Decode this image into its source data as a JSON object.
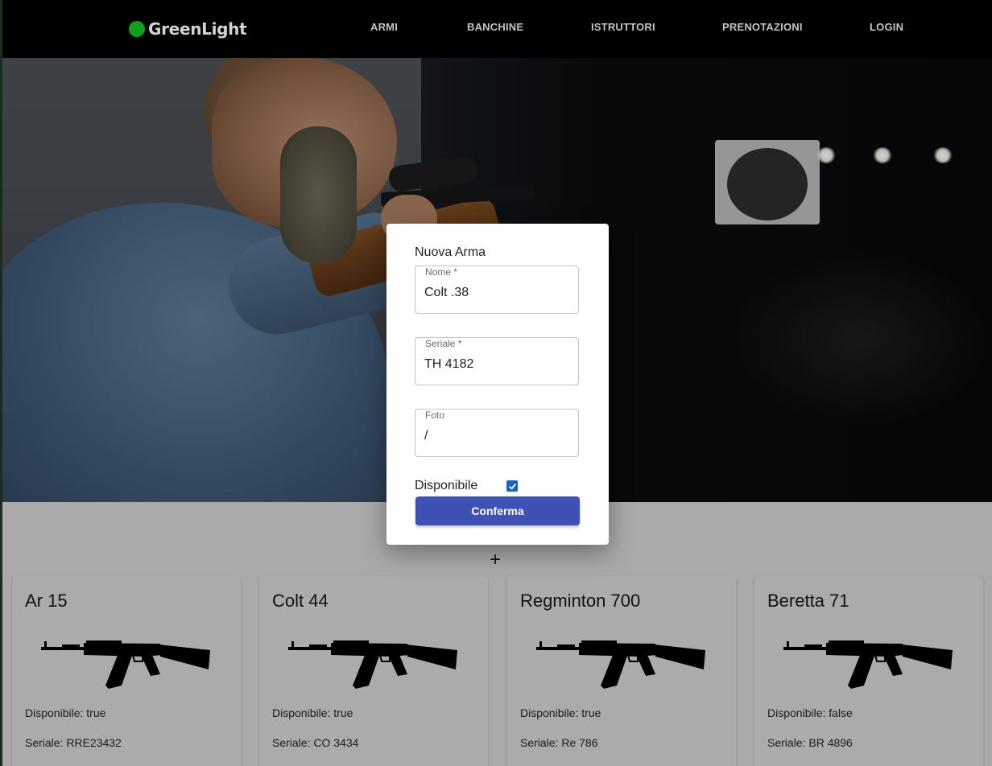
{
  "navbar": {
    "brand": "GreenLight",
    "links": [
      "ARMI",
      "BANCHINE",
      "ISTRUTTORI",
      "PRENOTAZIONI",
      "LOGIN"
    ]
  },
  "modal": {
    "title": "Nuova Arma",
    "fields": [
      {
        "label": "Nome *",
        "value": "Colt .38"
      },
      {
        "label": "Seriale *",
        "value": "TH 4182"
      },
      {
        "label": "Foto",
        "value": "/"
      }
    ],
    "available_label": "Disponibile",
    "available_checked": true,
    "confirm_label": "Conferma"
  },
  "add_button": "+",
  "weapons": [
    {
      "name": "Ar 15",
      "available": "Disponibile: true",
      "serial": "Seriale: RRE23432"
    },
    {
      "name": "Colt 44",
      "available": "Disponibile: true",
      "serial": "Seriale: CO 3434"
    },
    {
      "name": "Regminton 700",
      "available": "Disponibile: true",
      "serial": "Seriale: Re 786"
    },
    {
      "name": "Beretta 71",
      "available": "Disponibile: false",
      "serial": "Seriale: BR 4896"
    }
  ],
  "colors": {
    "navbar_bg": "#000000",
    "brand_dot": "#10a01c",
    "overlay_bg": "#a9a9a9",
    "confirm_button": "#3f51b5",
    "checkbox": "#1565c0"
  },
  "icons": {
    "brand": "green-circle-icon",
    "weapon": "rifle-silhouette-icon",
    "add": "plus-icon",
    "checkbox": "checkmark-icon"
  }
}
